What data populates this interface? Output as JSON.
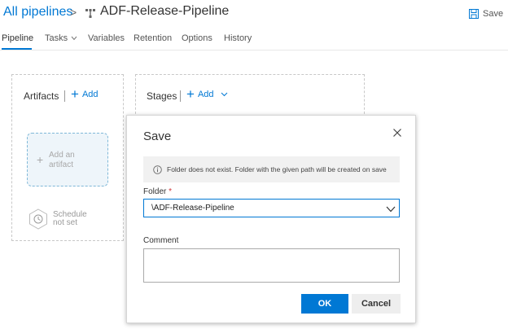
{
  "header": {
    "breadcrumb_root": "All pipelines",
    "breadcrumb_separator": ">",
    "pipeline_name": "ADF-Release-Pipeline",
    "save_label": "Save"
  },
  "tabs": [
    {
      "label": "Pipeline",
      "active": true
    },
    {
      "label": "Tasks",
      "dropdown": true
    },
    {
      "label": "Variables"
    },
    {
      "label": "Retention"
    },
    {
      "label": "Options"
    },
    {
      "label": "History"
    }
  ],
  "artifacts": {
    "title": "Artifacts",
    "add_label": "Add",
    "add_artifact_line1": "Add an",
    "add_artifact_line2": "artifact",
    "schedule_line1": "Schedule",
    "schedule_line2": "not set"
  },
  "stages": {
    "title": "Stages",
    "add_label": "Add"
  },
  "dialog": {
    "title": "Save",
    "info_message": "Folder does not exist. Folder with the given path will be created on save",
    "folder_label": "Folder",
    "required_marker": "*",
    "folder_value": "\\ADF-Release-Pipeline",
    "comment_label": "Comment",
    "comment_value": "",
    "ok_label": "OK",
    "cancel_label": "Cancel"
  },
  "colors": {
    "accent": "#0078d4",
    "required": "#d13438",
    "artifact_fill": "#eef5fa"
  },
  "icons": [
    "pipeline-icon",
    "save-icon",
    "chevron-down-icon",
    "plus-icon",
    "schedule-icon",
    "info-icon",
    "close-icon"
  ]
}
